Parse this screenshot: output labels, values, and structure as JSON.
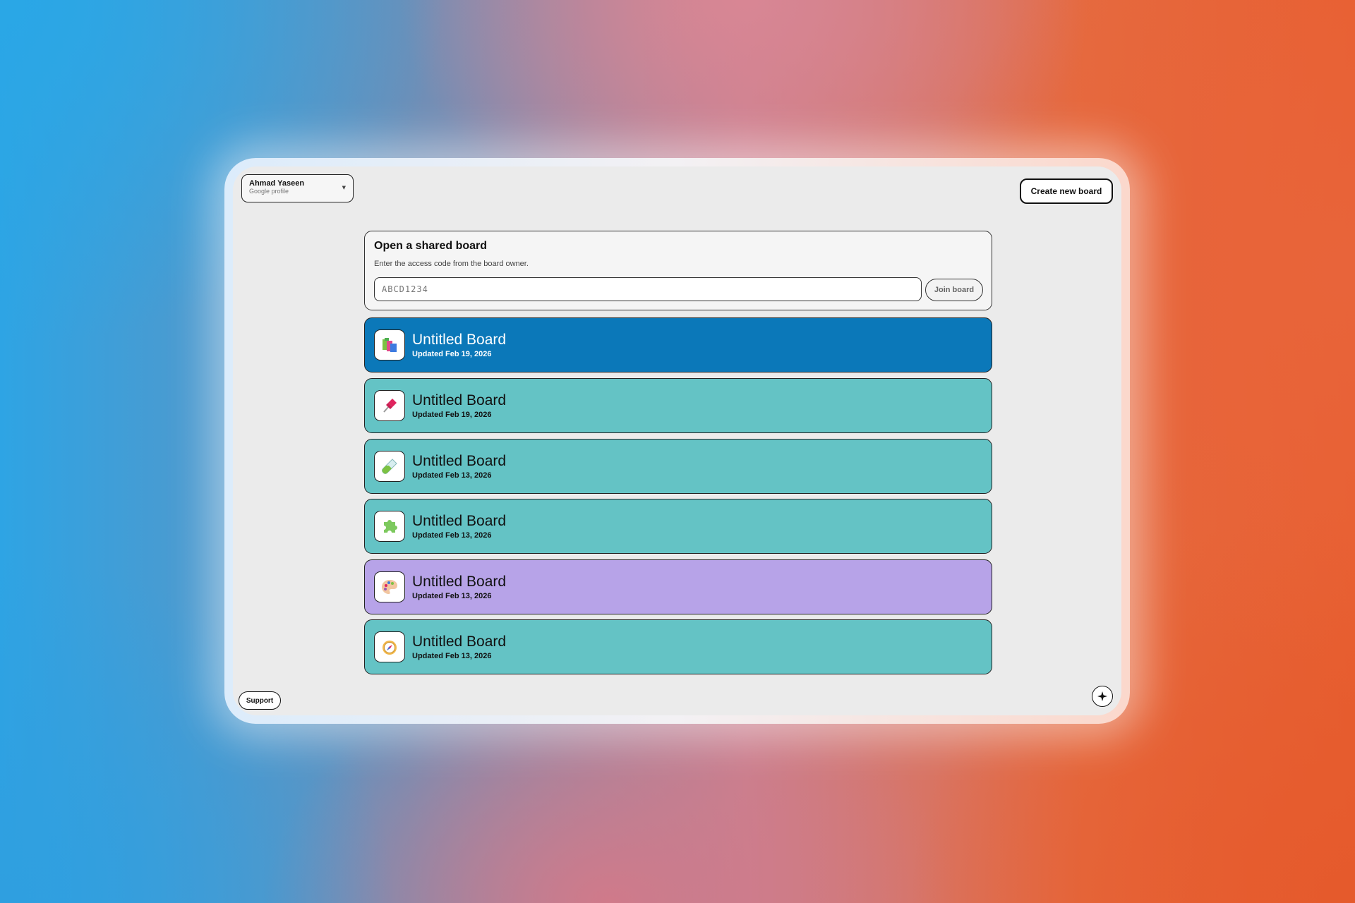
{
  "profile": {
    "name": "Ahmad Yaseen",
    "subtitle": "Google profile"
  },
  "header": {
    "create_label": "Create new board"
  },
  "shared": {
    "title": "Open a shared board",
    "description": "Enter the access code from the board owner.",
    "placeholder": "ABCD1234",
    "join_label": "Join board"
  },
  "boards": [
    {
      "title": "Untitled Board",
      "updated": "Updated Feb 19, 2026",
      "icon": "books-icon",
      "color": "#0b78b9",
      "text_color": "#ffffff"
    },
    {
      "title": "Untitled Board",
      "updated": "Updated Feb 19, 2026",
      "icon": "pushpin-icon",
      "color": "#64c3c5",
      "text_color": "#111111"
    },
    {
      "title": "Untitled Board",
      "updated": "Updated Feb 13, 2026",
      "icon": "test-tube-icon",
      "color": "#64c3c5",
      "text_color": "#111111"
    },
    {
      "title": "Untitled Board",
      "updated": "Updated Feb 13, 2026",
      "icon": "puzzle-icon",
      "color": "#64c3c5",
      "text_color": "#111111"
    },
    {
      "title": "Untitled Board",
      "updated": "Updated Feb 13, 2026",
      "icon": "palette-icon",
      "color": "#b7a3e8",
      "text_color": "#111111"
    },
    {
      "title": "Untitled Board",
      "updated": "Updated Feb 13, 2026",
      "icon": "compass-icon",
      "color": "#64c3c5",
      "text_color": "#111111"
    }
  ],
  "footer": {
    "support_label": "Support",
    "assistant_icon": "sparkle-icon"
  }
}
